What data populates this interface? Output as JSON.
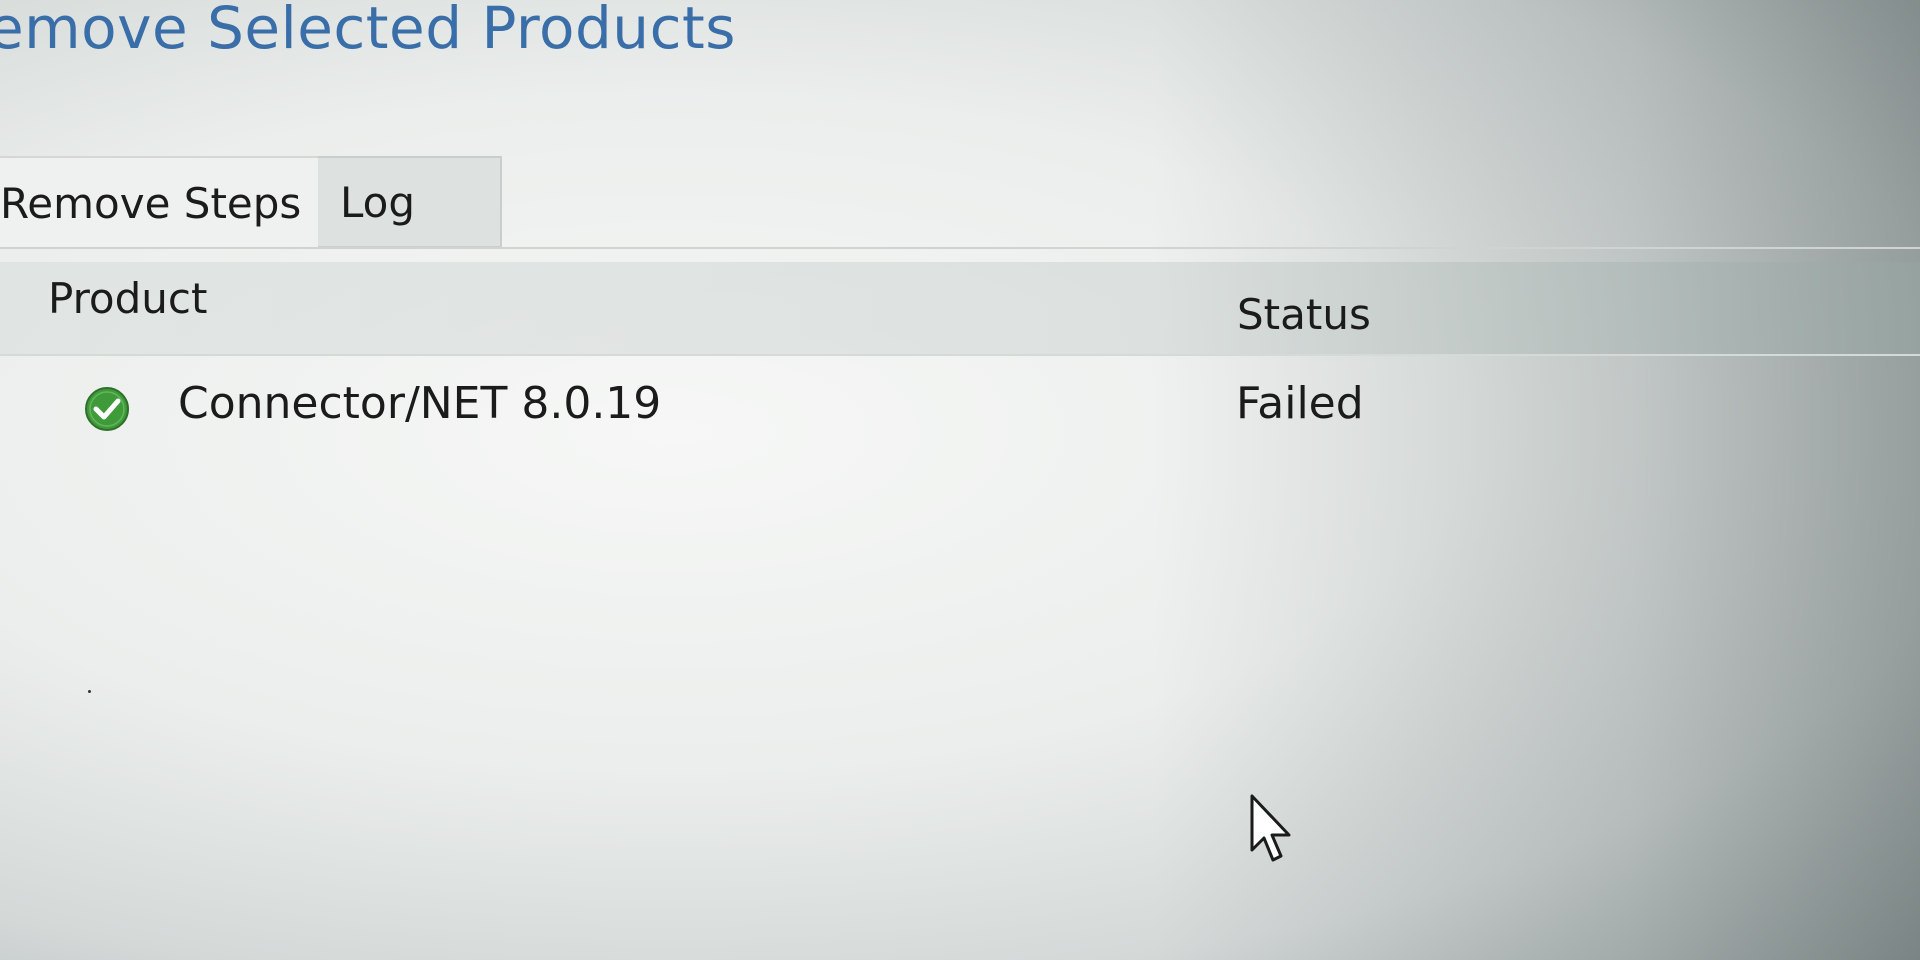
{
  "window": {
    "title": "emove Selected Products"
  },
  "tabs": [
    {
      "label": "Remove Steps",
      "active": true
    },
    {
      "label": "Log",
      "active": false
    }
  ],
  "table": {
    "columns": {
      "product": "Product",
      "status": "Status"
    },
    "rows": [
      {
        "icon": "check-circle-icon",
        "product": "Connector/NET 8.0.19",
        "status": "Failed"
      }
    ]
  },
  "colors": {
    "title": "#3a6ea8",
    "check_icon": "#3f9b3a"
  }
}
